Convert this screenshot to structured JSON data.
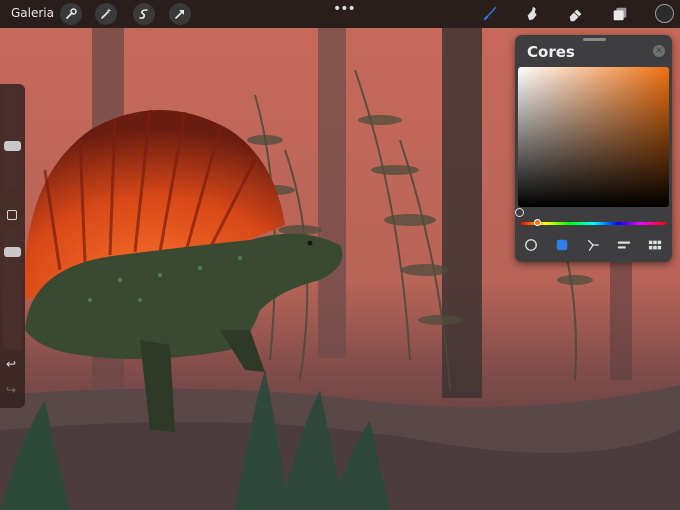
{
  "topbar": {
    "gallery_label": "Galeria",
    "tools_left": [
      "wrench-icon",
      "magic-wand-icon",
      "selection-icon",
      "transform-arrow-icon"
    ],
    "more_label": "•••",
    "tools_right": [
      "brush-icon",
      "smudge-icon",
      "eraser-icon",
      "layers-icon"
    ],
    "current_color": "#2b2b2b",
    "active_tool_color": "#2f7de8"
  },
  "sidebar": {
    "brush_size_level": 0.42,
    "opacity_level": 0.85
  },
  "color_panel": {
    "title": "Cores",
    "selected_hue": "#f07010",
    "modes": [
      "disc-icon",
      "classic-square-icon",
      "harmony-icon",
      "value-sliders-icon",
      "palettes-grid-icon"
    ],
    "active_mode": 1
  }
}
